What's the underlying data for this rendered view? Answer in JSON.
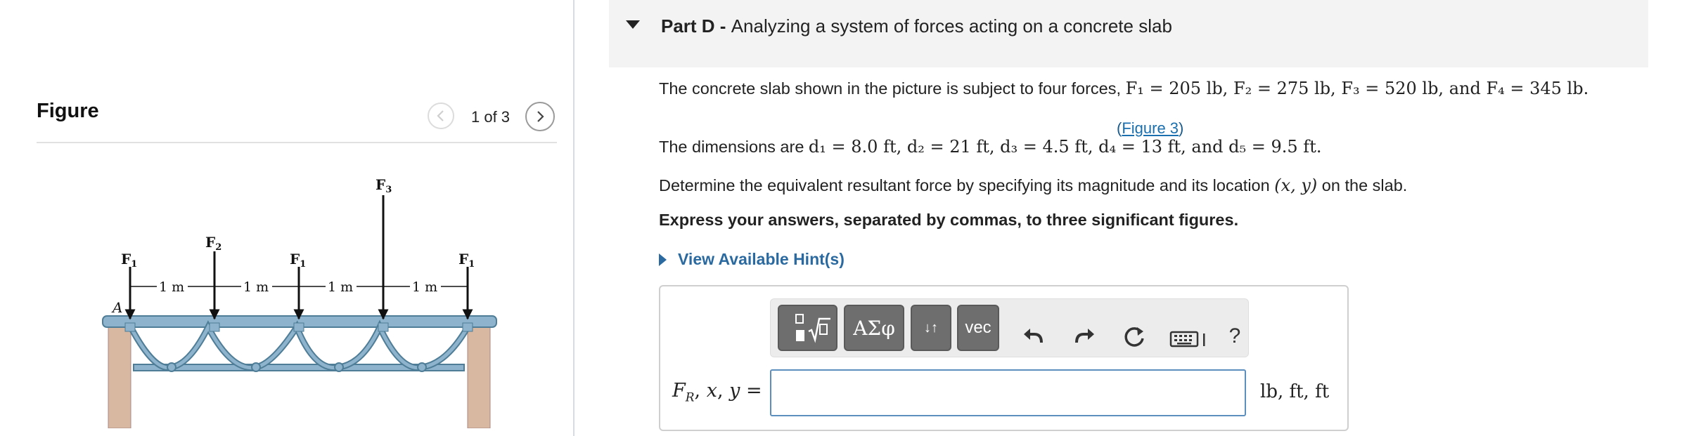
{
  "figure_pane": {
    "title": "Figure",
    "pager": "1 of 3",
    "prev_icon": "chevron-left-icon",
    "next_icon": "chevron-right-icon",
    "diagram_labels": {
      "point_a": "A",
      "f1": "F",
      "f1_sub": "1",
      "f2": "F",
      "f2_sub": "2",
      "f3": "F",
      "f3_sub": "3",
      "spacing": "1 m"
    }
  },
  "part": {
    "label": "Part D - ",
    "title": "Analyzing a system of forces acting on a concrete slab"
  },
  "problem": {
    "line1_text": "The concrete slab shown in the picture is subject to four forces, ",
    "line1_math": "F₁ = 205 lb, F₂ = 275 lb, F₃ = 520 lb, and F₄ = 345 lb.",
    "figure_link_open": "(",
    "figure_link": "Figure 3",
    "figure_link_close": ")",
    "line2_text": "The dimensions are ",
    "line2_math": "d₁ = 8.0 ft, d₂ = 21 ft, d₃ = 4.5 ft, d₄ = 13 ft, and d₅ = 9.5 ft.",
    "line3_text_a": "Determine the equivalent resultant force by specifying its magnitude and its location ",
    "line3_math": "(x, y)",
    "line3_text_b": " on the slab.",
    "instruction": "Express your answers, separated by commas, to three significant figures.",
    "hint": "View Available Hint(s)"
  },
  "answer": {
    "toolbar": {
      "templates_icon": "templates-icon",
      "greek_label": "ΑΣφ",
      "arrows_label": "↓↑",
      "vec_label": "vec",
      "undo_icon": "undo-icon",
      "redo_icon": "redo-icon",
      "reset_icon": "reset-icon",
      "keyboard_icon": "keyboard-icon",
      "help_label": "?"
    },
    "label": "F_R, x, y =",
    "value": "",
    "units": "lb, ft, ft"
  },
  "colors": {
    "link": "#1a6fae",
    "hint": "#2a6aa0",
    "input_border": "#5c8fbd",
    "toolbar_button": "#6e6e6e",
    "header_bg": "#f3f3f3"
  }
}
